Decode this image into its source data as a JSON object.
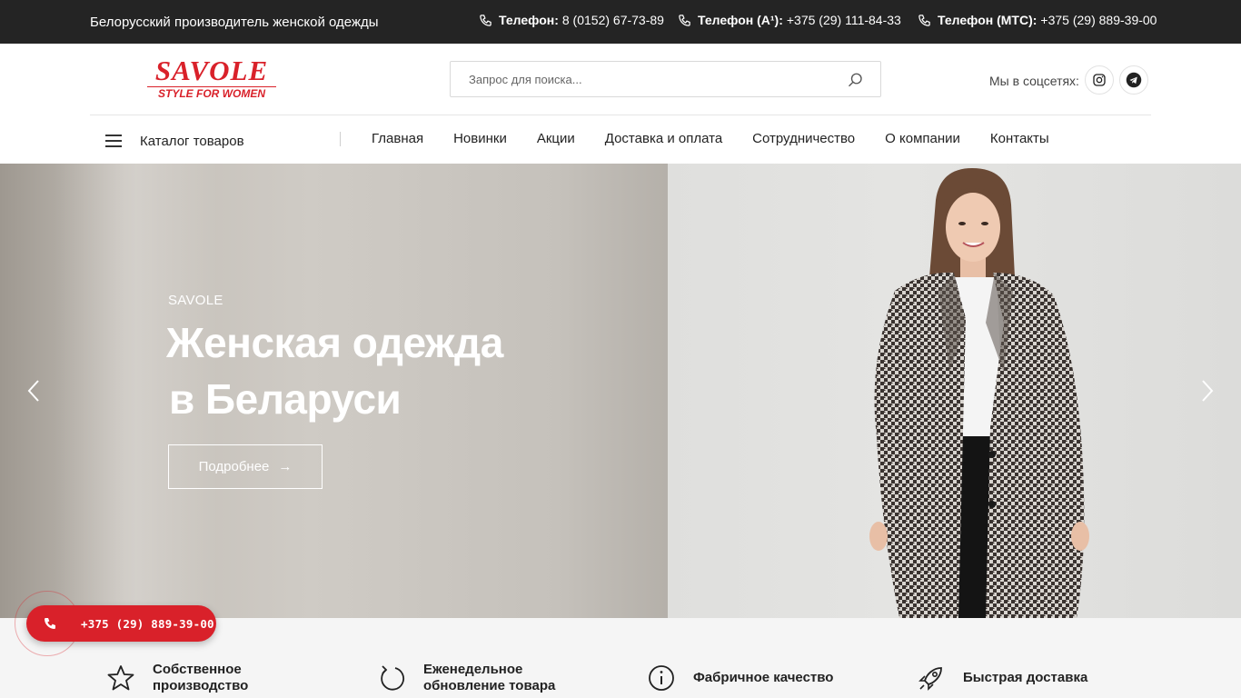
{
  "topbar": {
    "tagline": "Белорусский производитель женской одежды",
    "phones": [
      {
        "label": "Телефон:",
        "number": "8 (0152) 67-73-89"
      },
      {
        "label": "Телефон (A¹):",
        "number": "+375 (29) 111-84-33"
      },
      {
        "label": "Телефон (МТС):",
        "number": "+375 (29) 889-39-00"
      }
    ]
  },
  "header": {
    "logo": {
      "brand": "SAVOLE",
      "slogan": "STYLE FOR WOMEN"
    },
    "search": {
      "placeholder": "Запрос для поиска..."
    },
    "social_label": "Мы в соцсетях:",
    "social_icons": [
      "instagram-icon",
      "telegram-icon"
    ]
  },
  "nav": {
    "catalog_label": "Каталог товаров",
    "items": [
      "Главная",
      "Новинки",
      "Акции",
      "Доставка и оплата",
      "Сотрудничество",
      "О компании",
      "Контакты"
    ]
  },
  "hero": {
    "subtitle": "SAVOLE",
    "title_line1": "Женская одежда",
    "title_line2": "в Беларуси",
    "button_label": "Подробнее"
  },
  "features": [
    {
      "icon": "star-icon",
      "line1": "Собственное",
      "line2": "производство"
    },
    {
      "icon": "refresh-icon",
      "line1": "Еженедельное",
      "line2": "обновление товара"
    },
    {
      "icon": "info-icon",
      "line1": "Фабричное качество",
      "line2": ""
    },
    {
      "icon": "rocket-icon",
      "line1": "Быстрая доставка",
      "line2": ""
    }
  ],
  "call_widget": {
    "number": "+375 (29) 889-39-00"
  },
  "colors": {
    "accent": "#d9212a",
    "topbar_bg": "#242424",
    "features_bg": "#f5f5f5"
  }
}
